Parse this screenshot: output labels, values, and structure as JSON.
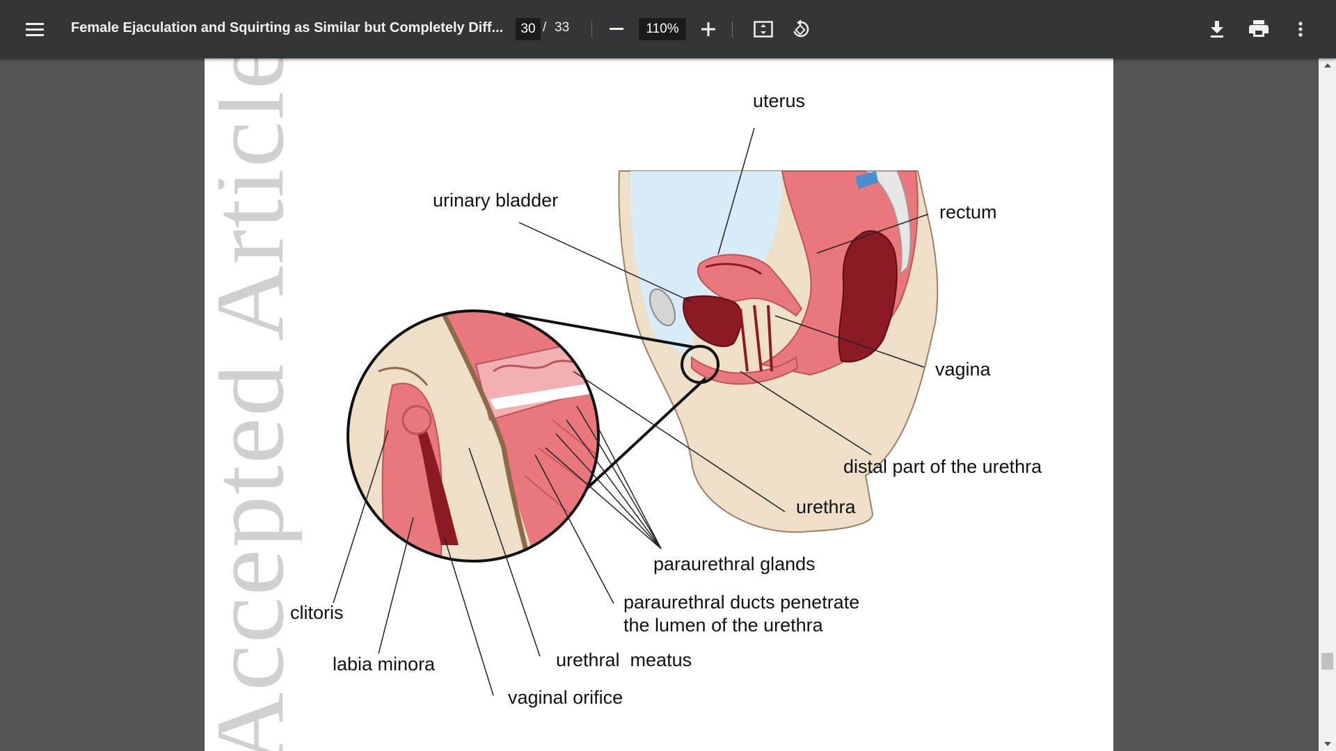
{
  "toolbar": {
    "title": "Female Ejaculation and Squirting as Similar but Completely Diff...",
    "current_page": "30",
    "page_separator": "/",
    "total_pages": "33",
    "zoom": "110%",
    "icons": [
      "menu-icon",
      "minus-icon",
      "plus-icon",
      "fit-page-icon",
      "rotate-icon",
      "download-icon",
      "print-icon",
      "more-vert-icon"
    ]
  },
  "page": {
    "watermark": "Accepted Article",
    "labels": {
      "uterus": "uterus",
      "urinary_bladder": "urinary bladder",
      "rectum": "rectum",
      "vagina": "vagina",
      "distal_urethra": "distal part of the urethra",
      "urethra": "urethra",
      "paraurethral_glands": "paraurethral glands",
      "ducts_line1": "paraurethral ducts penetrate",
      "ducts_line2": "the lumen of the urethra",
      "clitoris": "clitoris",
      "labia_minora": "labia minora",
      "urethral_meatus": "urethral  meatus",
      "vaginal_orifice": "vaginal orifice"
    }
  },
  "colors": {
    "toolbar_bg": "#323639",
    "viewer_bg": "#525659",
    "tissue_pink": "#e8787c",
    "dark_red": "#8b1a24",
    "skin": "#eedfc8",
    "bladder_fill": "#d8ecf7"
  }
}
